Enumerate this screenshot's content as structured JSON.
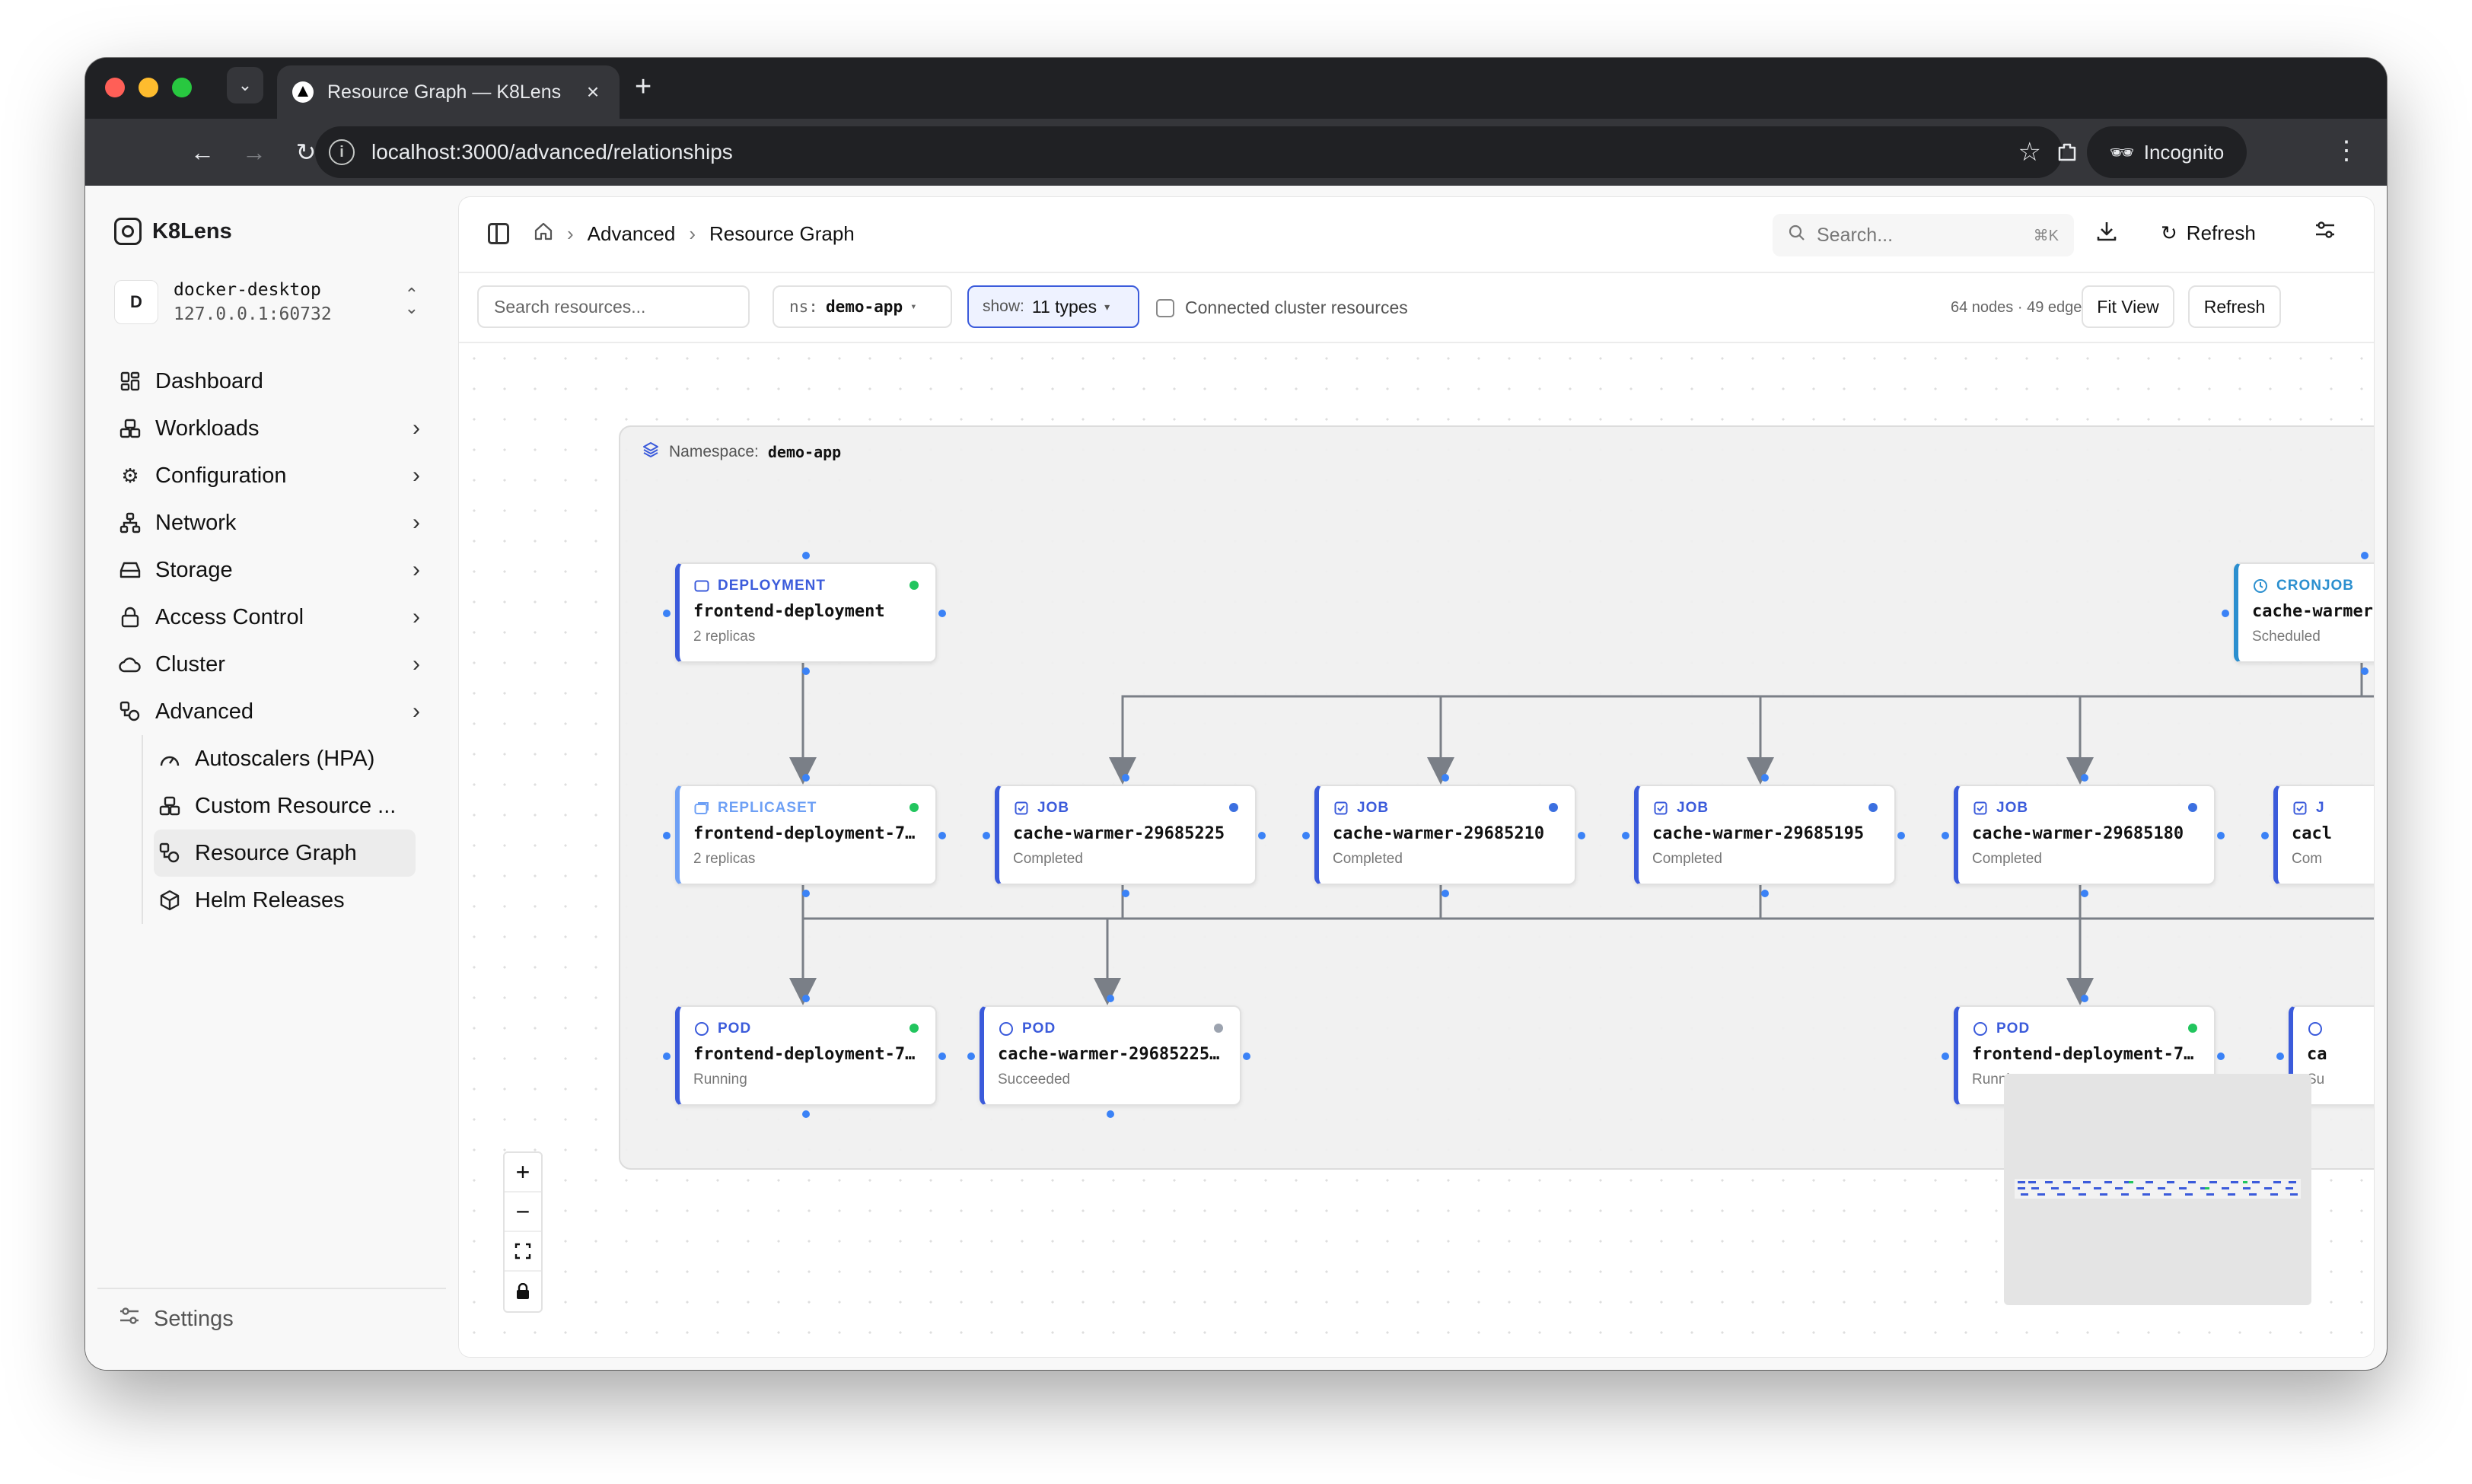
{
  "browser": {
    "tab_title": "Resource Graph — K8Lens",
    "url": "localhost:3000/advanced/relationships",
    "profile_label": "Incognito",
    "new_tab": "+",
    "close": "×"
  },
  "sidebar": {
    "brand": "K8Lens",
    "cluster_avatar": "D",
    "cluster_name": "docker-desktop",
    "cluster_address": "127.0.0.1:60732",
    "items": [
      {
        "label": "Dashboard"
      },
      {
        "label": "Workloads"
      },
      {
        "label": "Configuration"
      },
      {
        "label": "Network"
      },
      {
        "label": "Storage"
      },
      {
        "label": "Access Control"
      },
      {
        "label": "Cluster"
      },
      {
        "label": "Advanced"
      }
    ],
    "subitems": [
      {
        "label": "Autoscalers (HPA)"
      },
      {
        "label": "Custom Resource ..."
      },
      {
        "label": "Resource Graph"
      },
      {
        "label": "Helm Releases"
      }
    ],
    "settings": "Settings"
  },
  "header": {
    "breadcrumb_1": "Advanced",
    "breadcrumb_2": "Resource Graph",
    "search_placeholder": "Search...",
    "search_shortcut": "⌘K",
    "refresh": "Refresh"
  },
  "filters": {
    "search_placeholder": "Search resources...",
    "ns_prefix": "ns:",
    "ns_value": "demo-app",
    "show_prefix": "show:",
    "show_value": "11 types",
    "connected_label": "Connected cluster resources",
    "counts": "64 nodes · 49 edges",
    "fit_view": "Fit View",
    "refresh": "Refresh"
  },
  "graph": {
    "namespace_label": "Namespace:",
    "namespace_value": "demo-app",
    "nodes": [
      {
        "kind": "DEPLOYMENT",
        "name": "frontend-deployment",
        "status": "2 replicas",
        "dot": "#22c55e"
      },
      {
        "kind": "CRONJOB",
        "name": "cache-warmer",
        "status": "Scheduled",
        "dot": "#3b6fe0"
      },
      {
        "kind": "REPLICASET",
        "name": "frontend-deployment-7…",
        "status": "2 replicas",
        "dot": "#22c55e"
      },
      {
        "kind": "JOB",
        "name": "cache-warmer-29685225",
        "status": "Completed",
        "dot": "#3b6fe0"
      },
      {
        "kind": "JOB",
        "name": "cache-warmer-29685210",
        "status": "Completed",
        "dot": "#3b6fe0"
      },
      {
        "kind": "JOB",
        "name": "cache-warmer-29685195",
        "status": "Completed",
        "dot": "#3b6fe0"
      },
      {
        "kind": "JOB",
        "name": "cache-warmer-29685180",
        "status": "Completed",
        "dot": "#3b6fe0"
      },
      {
        "kind": "J",
        "name": "cacl",
        "status": "Com",
        "dot": "#3b6fe0"
      },
      {
        "kind": "POD",
        "name": "frontend-deployment-7…",
        "status": "Running",
        "dot": "#22c55e"
      },
      {
        "kind": "POD",
        "name": "cache-warmer-29685225…",
        "status": "Succeeded",
        "dot": "#9ca3af"
      },
      {
        "kind": "POD",
        "name": "frontend-deployment-7…",
        "status": "Running",
        "dot": "#22c55e"
      },
      {
        "kind": "",
        "name": "ca",
        "status": "Su",
        "dot": "#9ca3af"
      }
    ]
  },
  "zoom": {
    "in": "+",
    "out": "−"
  },
  "colors": {
    "accent": "#3b5bdb",
    "running": "#22c55e",
    "edge": "#7a7f87"
  }
}
